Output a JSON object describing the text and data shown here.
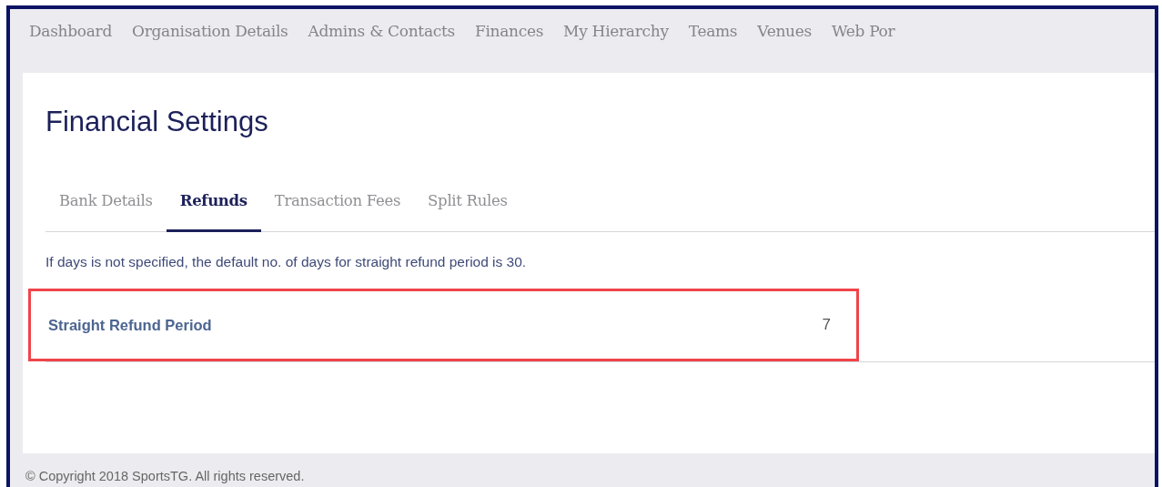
{
  "nav": [
    {
      "label": "Dashboard"
    },
    {
      "label": "Organisation Details"
    },
    {
      "label": "Admins & Contacts"
    },
    {
      "label": "Finances"
    },
    {
      "label": "My Hierarchy"
    },
    {
      "label": "Teams"
    },
    {
      "label": "Venues"
    },
    {
      "label": "Web Por"
    }
  ],
  "page_title": "Financial Settings",
  "tabs": [
    {
      "label": "Bank Details",
      "selected": false
    },
    {
      "label": "Refunds",
      "selected": true
    },
    {
      "label": "Transaction Fees",
      "selected": false
    },
    {
      "label": "Split Rules",
      "selected": false
    }
  ],
  "info_text": "If days is not specified, the default no. of days for straight refund period is 30.",
  "settings": [
    {
      "label": "Straight Refund Period",
      "value": "7",
      "highlighted": true
    }
  ],
  "footer": "© Copyright 2018 SportsTG. All rights reserved."
}
